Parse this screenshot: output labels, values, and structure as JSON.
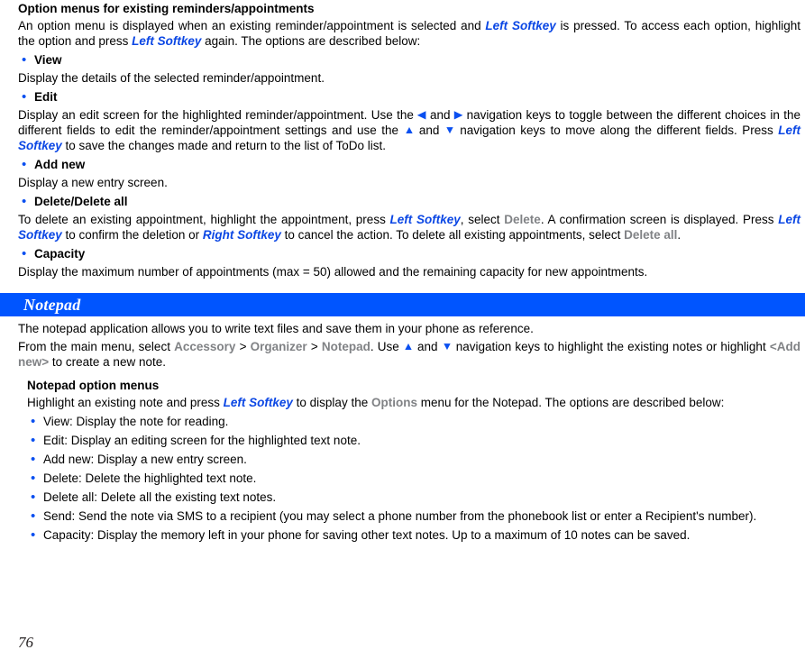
{
  "page": {
    "number": "76"
  },
  "section_appointments": {
    "heading": "Option menus for existing reminders/appointments",
    "intro_part1": "An option menu is displayed when an existing reminder/appointment is selected and ",
    "intro_softkey1": "Left Softkey",
    "intro_part2": " is pressed. To access each option, highlight the option and press ",
    "intro_softkey2": "Left Softkey",
    "intro_part3": " again. The options are described below:",
    "options": [
      {
        "label": "View",
        "description": "Display the details of the selected reminder/appointment."
      },
      {
        "label": "Edit",
        "description": "Display an edit screen for the highlighted reminder/appointment. Use the ◀ and ▶ navigation keys to toggle between the different choices in the different fields to edit the reminder/appointment settings and use the ▲ and ▼ navigation keys to move along the different fields. Press Left Softkey to save the changes made and return to the list of ToDo list."
      },
      {
        "label": "Add new",
        "description": "Display a new entry screen."
      },
      {
        "label": "Delete/Delete all",
        "description": "To delete an existing appointment, highlight the appointment, press Left Softkey, select Delete. A confirmation screen is displayed. Press Left Softkey  to confirm the deletion or Right Softkey  to cancel the action. To delete all existing appointments, select Delete all."
      },
      {
        "label": "Capacity",
        "description": "Display the maximum number of appointments (max = 50) allowed and the remaining capacity for new appointments."
      }
    ],
    "edit_text": {
      "p1": "Display an edit screen for the highlighted reminder/appointment. Use the ",
      "arrow_left": "◀",
      "p2": " and ",
      "arrow_right": "▶",
      "p3": " navigation keys to toggle between the different choices in the different fields to edit the reminder/appointment settings and use the ",
      "arrow_up": "▲",
      "p4": " and ",
      "arrow_down": "▼",
      "p5": " navigation keys to move along the different fields. Press ",
      "softkey": "Left Softkey",
      "p6": " to save the changes made and return to the list of ToDo list."
    },
    "delete_text": {
      "p1": "To delete an existing appointment, highlight the appointment, press ",
      "softkey1": "Left Softkey",
      "p2": ", select ",
      "menu1": "Delete",
      "p3": ". A confirmation screen is displayed. Press ",
      "softkey2": "Left Softkey",
      "p4": "  to confirm the deletion or ",
      "softkey3": "Right Softkey",
      "p5": "  to cancel the action. To delete all existing appointments, select ",
      "menu2": "Delete all",
      "p6": "."
    }
  },
  "section_notepad": {
    "band_title": "Notepad",
    "intro": "The notepad application allows you to write text files and save them in your phone as reference.",
    "path_text": {
      "p1": "From the main menu, select ",
      "m1": "Accessory",
      "sep1": " > ",
      "m2": "Organizer",
      "sep2": " > ",
      "m3": "Notepad",
      "p2": ". Use ",
      "arrow_up": "▲",
      "p3": " and ",
      "arrow_down": "▼",
      "p4": " navigation keys to highlight the existing notes or highlight ",
      "m4": "<Add new>",
      "p5": " to create a new note."
    },
    "option_menus": {
      "heading": "Notepad option menus",
      "intro_p1": "Highlight an existing note and press ",
      "softkey": "Left Softkey",
      "intro_p2": " to display the ",
      "menu": "Options",
      "intro_p3": " menu for the Notepad. The options are described below:",
      "items": [
        "View: Display the note for reading.",
        "Edit: Display an editing screen for the highlighted text note.",
        "Add new: Display a new entry screen.",
        "Delete: Delete the highlighted text note.",
        "Delete all: Delete all the existing text notes.",
        "Send: Send the note via SMS to a recipient (you may select a phone number from the phonebook list or enter a Recipient's number).",
        "Capacity: Display the memory left in your phone for saving other text notes. Up to a maximum of 10 notes can be saved."
      ]
    }
  },
  "colors": {
    "accent_blue": "#0055ff",
    "link_blue": "#0a46e4",
    "menu_gray": "#808285"
  }
}
